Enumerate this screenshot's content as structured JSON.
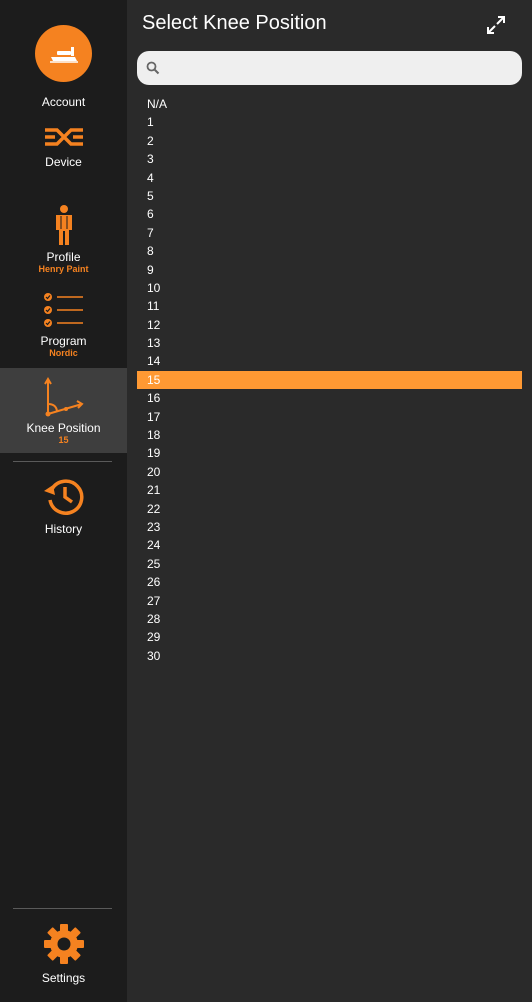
{
  "sidebar": {
    "account": {
      "label": "Account",
      "icon": "bed-icon"
    },
    "device": {
      "label": "Device",
      "icon": "device-logo-icon"
    },
    "profile": {
      "label": "Profile",
      "sub": "Henry Paint",
      "icon": "person-icon"
    },
    "program": {
      "label": "Program",
      "sub": "Nordic",
      "icon": "checklist-icon"
    },
    "knee_position": {
      "label": "Knee Position",
      "sub": "15",
      "icon": "axis-angle-icon"
    },
    "history": {
      "label": "History",
      "icon": "history-icon"
    },
    "settings": {
      "label": "Settings",
      "icon": "gear-icon"
    }
  },
  "main": {
    "title": "Select Knee Position",
    "search": {
      "placeholder": "",
      "value": ""
    },
    "options": [
      "N/A",
      "1",
      "2",
      "3",
      "4",
      "5",
      "6",
      "7",
      "8",
      "9",
      "10",
      "11",
      "12",
      "13",
      "14",
      "15",
      "16",
      "17",
      "18",
      "19",
      "20",
      "21",
      "22",
      "23",
      "24",
      "25",
      "26",
      "27",
      "28",
      "29",
      "30"
    ],
    "selected": "15"
  },
  "colors": {
    "accent": "#f58220",
    "selected_row": "#ff9933",
    "sidebar_bg": "#1c1c1c",
    "main_bg": "#2a2a2a"
  }
}
